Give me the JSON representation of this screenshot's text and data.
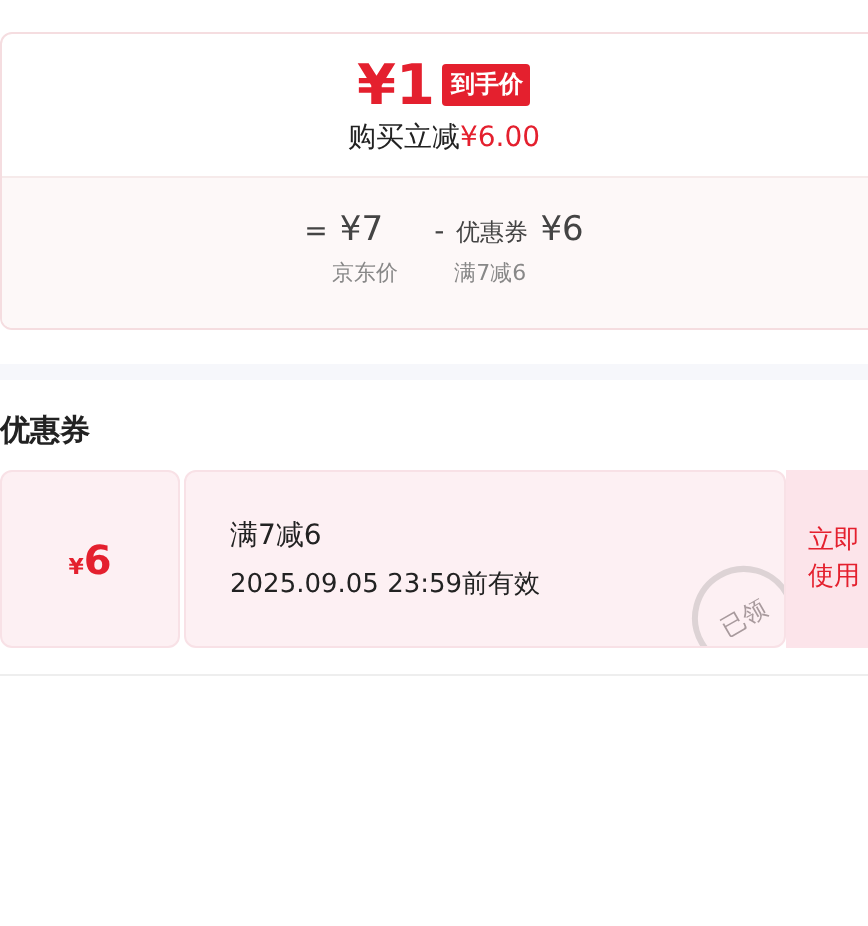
{
  "price_card": {
    "final_price": "¥1",
    "price_badge": "到手价",
    "saving_label": "购买立减",
    "saving_amount": "¥6.00",
    "breakdown": [
      {
        "kind": "base",
        "sign": "=",
        "amount": "¥7",
        "caption": "京东价"
      },
      {
        "kind": "coupon",
        "sign": "-",
        "name": "优惠券",
        "amount": "¥6",
        "caption": "满7减6"
      }
    ]
  },
  "coupons_section": {
    "title": "优惠券",
    "coupons": [
      {
        "amount_symbol": "¥",
        "amount": "6",
        "condition": "满7减6",
        "validity": "2025.09.05 23:59前有效",
        "stamp": "已领",
        "claimed": true,
        "action": "立即使用"
      }
    ]
  }
}
